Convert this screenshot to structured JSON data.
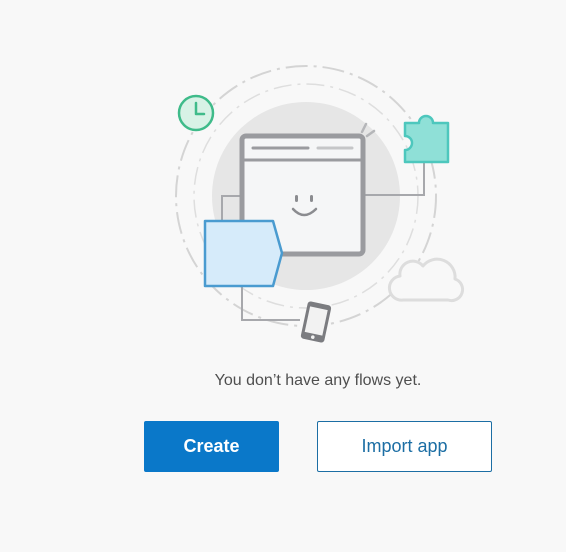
{
  "empty_state": {
    "message": "You don’t have any flows yet.",
    "create_label": "Create",
    "import_label": "Import app",
    "illustration_icons": [
      "clock-icon",
      "browser-window-icon",
      "smiley-face-icon",
      "puzzle-piece-icon",
      "folder-icon",
      "cloud-icon",
      "phone-icon"
    ]
  },
  "colors": {
    "background": "#f8f8f8",
    "primary": "#0a78c9",
    "outline": "#1c6ea4",
    "green": "#3fbb8a",
    "teal": "#4dc7bd",
    "blue_folder": "#4a9bd0",
    "gray": "#9a9b9f"
  }
}
